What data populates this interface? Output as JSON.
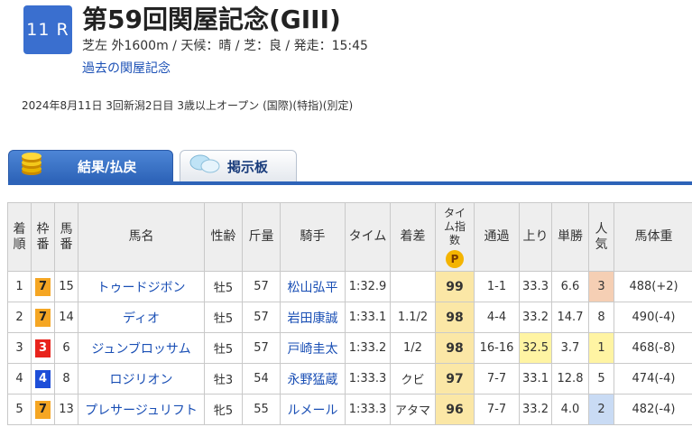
{
  "race": {
    "number": "11 R",
    "title": "第59回関屋記念(GIII)",
    "conditions": "芝左 外1600m / 天候：晴 / 芝：良 / 発走：15:45",
    "past_link": "過去の関屋記念",
    "date_line": "2024年8月11日 3回新潟2日目 3歳以上オープン (国際)(特指)(別定)"
  },
  "tabs": {
    "results": "結果/払戻",
    "board": "掲示板"
  },
  "table": {
    "headers": {
      "place": "着順",
      "frame": "枠番",
      "horse_no": "馬番",
      "name": "馬名",
      "sex_age": "性齢",
      "weight_carried": "斤量",
      "jockey": "騎手",
      "time": "タイム",
      "margin": "着差",
      "time_index": "タイム指数",
      "index_badge": "P",
      "passing": "通過",
      "last3f": "上り",
      "odds": "単勝",
      "popularity": "人気",
      "body_weight": "馬体重"
    },
    "rows": [
      {
        "place": "1",
        "frame": "7",
        "horse_no": "15",
        "name": "トゥードジボン",
        "sex_age": "牡5",
        "weight": "57",
        "jockey": "松山弘平",
        "time": "1:32.9",
        "margin": "",
        "index": "99",
        "passing": "1-1",
        "last3f": "33.3",
        "odds": "6.6",
        "pop": "3",
        "body": "488(+2)"
      },
      {
        "place": "2",
        "frame": "7",
        "horse_no": "14",
        "name": "ディオ",
        "sex_age": "牡5",
        "weight": "57",
        "jockey": "岩田康誠",
        "time": "1:33.1",
        "margin": "1.1/2",
        "index": "98",
        "passing": "4-4",
        "last3f": "33.2",
        "odds": "14.7",
        "pop": "8",
        "body": "490(-4)"
      },
      {
        "place": "3",
        "frame": "3",
        "horse_no": "6",
        "name": "ジュンブロッサム",
        "sex_age": "牡5",
        "weight": "57",
        "jockey": "戸崎圭太",
        "time": "1:33.2",
        "margin": "1/2",
        "index": "98",
        "passing": "16-16",
        "last3f": "32.5",
        "odds": "3.7",
        "pop": "1",
        "body": "468(-8)"
      },
      {
        "place": "4",
        "frame": "4",
        "horse_no": "8",
        "name": "ロジリオン",
        "sex_age": "牡3",
        "weight": "54",
        "jockey": "永野猛蔵",
        "time": "1:33.3",
        "margin": "クビ",
        "index": "97",
        "passing": "7-7",
        "last3f": "33.1",
        "odds": "12.8",
        "pop": "5",
        "body": "474(-4)"
      },
      {
        "place": "5",
        "frame": "7",
        "horse_no": "13",
        "name": "プレサージュリフト",
        "sex_age": "牝5",
        "weight": "55",
        "jockey": "ルメール",
        "time": "1:33.3",
        "margin": "アタマ",
        "index": "96",
        "passing": "7-7",
        "last3f": "33.2",
        "odds": "4.0",
        "pop": "2",
        "body": "482(-4)"
      }
    ]
  },
  "colors": {
    "race_badge": "#3a6fcf",
    "link": "#1a4fb5",
    "frame_3": "#e8231c",
    "frame_4": "#1d4ed8",
    "frame_7": "#f5a623",
    "time_index_bg": "#fbe7a6",
    "popularity_1": "#fff4a3",
    "popularity_2": "#c9dbf4",
    "popularity_3": "#f5cfb4"
  },
  "icons": {
    "results_tab": "coins-icon",
    "board_tab": "chat-bubbles-icon"
  }
}
